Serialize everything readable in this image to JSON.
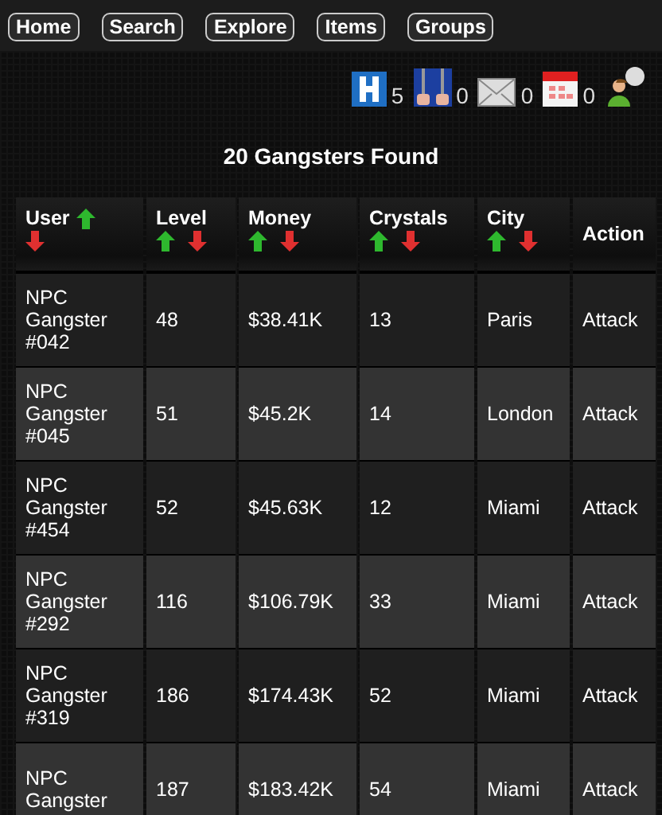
{
  "nav": [
    "Home",
    "Search",
    "Explore",
    "Items",
    "Groups"
  ],
  "status": [
    {
      "kind": "hospital",
      "count": "5"
    },
    {
      "kind": "jail",
      "count": "0"
    },
    {
      "kind": "mail",
      "count": "0"
    },
    {
      "kind": "calendar",
      "count": "0"
    },
    {
      "kind": "profile"
    }
  ],
  "title": "20 Gangsters Found",
  "table": {
    "columns": [
      {
        "label": "User",
        "kind": "sortable"
      },
      {
        "label": "Level",
        "kind": "sortable"
      },
      {
        "label": "Money",
        "kind": "sortable"
      },
      {
        "label": "Crystals",
        "kind": "sortable"
      },
      {
        "label": "City",
        "kind": "sortable"
      },
      {
        "label": "Action",
        "kind": "plain"
      }
    ],
    "rows": [
      [
        "NPC Gangster #042",
        "48",
        "$38.41K",
        "13",
        "Paris",
        "Attack"
      ],
      [
        "NPC Gangster #045",
        "51",
        "$45.2K",
        "14",
        "London",
        "Attack"
      ],
      [
        "NPC Gangster #454",
        "52",
        "$45.63K",
        "12",
        "Miami",
        "Attack"
      ],
      [
        "NPC Gangster #292",
        "116",
        "$106.79K",
        "33",
        "Miami",
        "Attack"
      ],
      [
        "NPC Gangster #319",
        "186",
        "$174.43K",
        "52",
        "Miami",
        "Attack"
      ],
      [
        "NPC Gangster",
        "187",
        "$183.42K",
        "54",
        "Miami",
        "Attack"
      ]
    ]
  }
}
